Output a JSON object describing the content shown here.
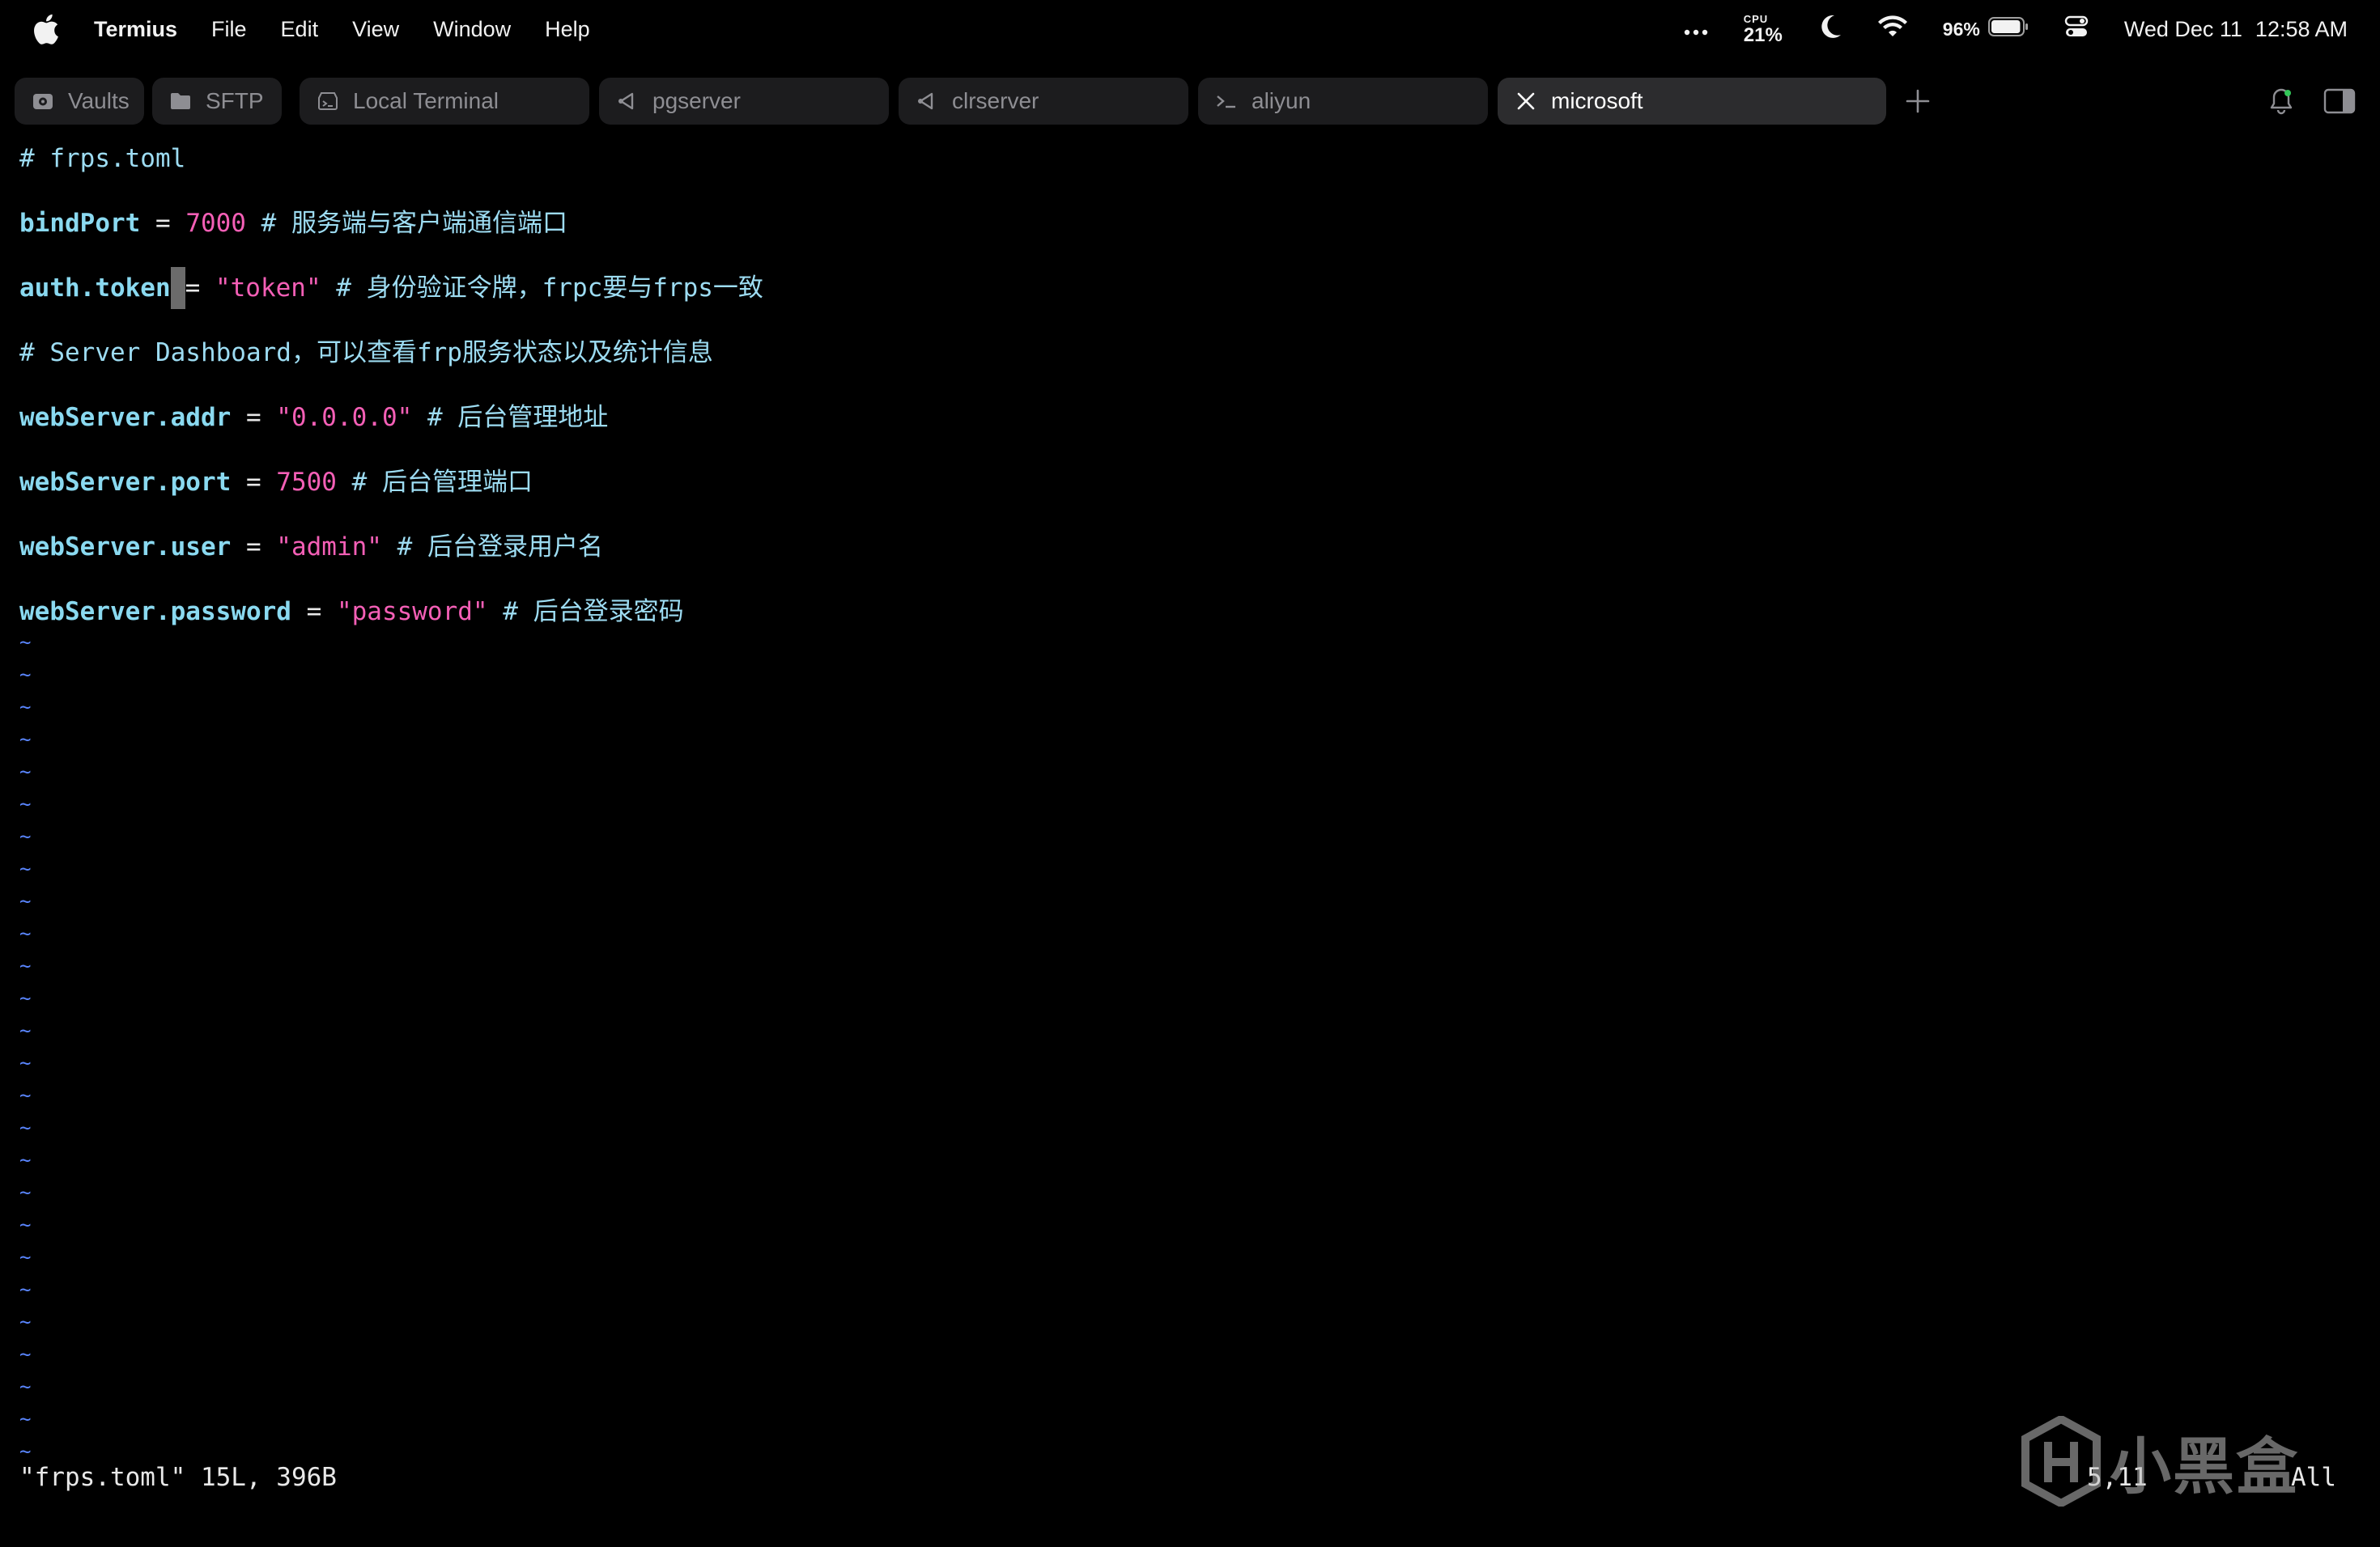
{
  "menubar": {
    "apple_icon": "apple-logo-icon",
    "app_name": "Termius",
    "items": [
      "File",
      "Edit",
      "View",
      "Window",
      "Help"
    ],
    "cpu_label": "CPU",
    "cpu_value": "21%",
    "battery_percent": "96%",
    "battery_level": 0.96,
    "date": "Wed Dec 11",
    "time": "12:58 AM"
  },
  "tabs": [
    {
      "label": "Vaults",
      "icon": "vault-icon",
      "active": false
    },
    {
      "label": "SFTP",
      "icon": "folder-icon",
      "active": false
    },
    {
      "label": "Local Terminal",
      "icon": "local-terminal-icon",
      "active": false
    },
    {
      "label": "pgserver",
      "icon": "ssh-host-icon",
      "active": false
    },
    {
      "label": "clrserver",
      "icon": "ssh-host-icon",
      "active": false
    },
    {
      "label": "aliyun",
      "icon": "terminal-prompt-icon",
      "active": false
    },
    {
      "label": "microsoft",
      "icon": "close-icon",
      "active": true
    }
  ],
  "editor": {
    "lines": [
      {
        "comment": "# frps.toml"
      },
      {
        "key": "bindPort",
        "op": " = ",
        "value": "7000",
        "value_kind": "num",
        "comment": " # 服务端与客户端通信端口"
      },
      {
        "key": "auth.token",
        "cursor_char": " ",
        "op": "= ",
        "value": "\"token\"",
        "value_kind": "str",
        "comment": " # 身份验证令牌，frpc要与frps一致"
      },
      {
        "comment": "# Server Dashboard，可以查看frp服务状态以及统计信息"
      },
      {
        "key": "webServer.addr",
        "op": " = ",
        "value": "\"0.0.0.0\"",
        "value_kind": "str",
        "comment": " # 后台管理地址"
      },
      {
        "key": "webServer.port",
        "op": " = ",
        "value": "7500",
        "value_kind": "num",
        "comment": " # 后台管理端口"
      },
      {
        "key": "webServer.user",
        "op": " = ",
        "value": "\"admin\"",
        "value_kind": "str",
        "comment": " # 后台登录用户名"
      },
      {
        "key": "webServer.password",
        "op": " = ",
        "value": "\"password\"",
        "value_kind": "str",
        "comment": " # 后台登录密码"
      }
    ],
    "empty_line_marker": "~",
    "empty_lines": 26,
    "status_message": "\"frps.toml\" 15L, 396B",
    "cursor_position": "5,11",
    "scroll_position": "All"
  },
  "watermark": {
    "text": "小黑盒"
  },
  "colors": {
    "background": "#000000",
    "tab_bg": "#1c1c1e",
    "tab_active_bg": "#2c2c2e",
    "keyword": "#8ad9f0",
    "value": "#f45fb6",
    "tilde": "#5a86ff"
  }
}
